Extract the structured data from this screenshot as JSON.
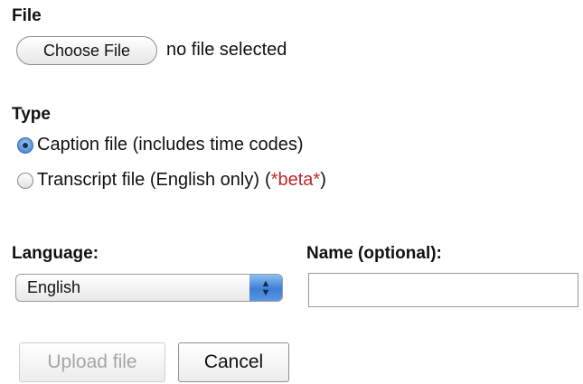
{
  "file": {
    "label": "File",
    "choose_button": "Choose File",
    "status": "no file selected"
  },
  "type": {
    "label": "Type",
    "options": [
      {
        "label": "Caption file (includes time codes)",
        "checked": true
      },
      {
        "label": "Transcript file (English only)",
        "note_open": "(",
        "note": "*beta*",
        "note_close": ")",
        "checked": false
      }
    ]
  },
  "language": {
    "label": "Language:",
    "selected": "English",
    "icon": "up-down-arrows-icon"
  },
  "name": {
    "label": "Name (optional):",
    "value": "",
    "placeholder": ""
  },
  "actions": {
    "upload_label": "Upload file",
    "upload_disabled": true,
    "cancel_label": "Cancel"
  },
  "colors": {
    "beta": "#c0262b",
    "radio_selected": "#3b78c8",
    "select_arrow": "#3d7fd6"
  }
}
